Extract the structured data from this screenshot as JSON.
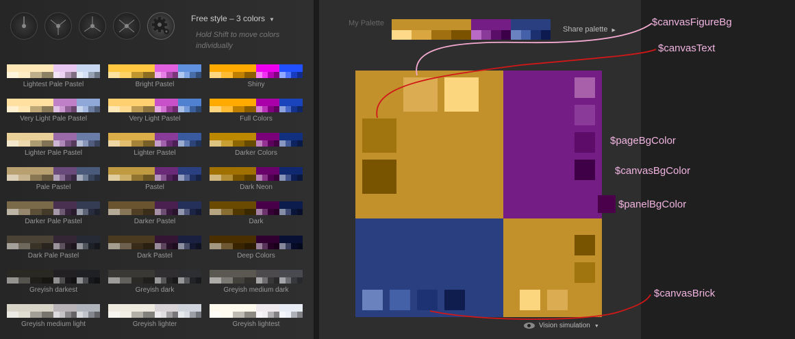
{
  "header": {
    "mode_label": "Free style – 3 colors",
    "hint": "Hold Shift to move colors individually"
  },
  "icons": [
    "mono-wheel-icon",
    "complement-wheel-icon",
    "triad-wheel-icon",
    "tetrad-wheel-icon",
    "gear-icon"
  ],
  "presets": [
    {
      "name": "Lightest Pale Pastel",
      "colors": [
        "#ffe8b8",
        "#e8c8f0",
        "#c8d8f0"
      ]
    },
    {
      "name": "Bright Pastel",
      "colors": [
        "#ffc840",
        "#e060e0",
        "#6090e0"
      ]
    },
    {
      "name": "Shiny",
      "colors": [
        "#ffaa00",
        "#ee00ee",
        "#2050ff"
      ]
    },
    {
      "name": "Very Light Pale Pastel",
      "colors": [
        "#ffe0a0",
        "#c080c8",
        "#90a8d8"
      ]
    },
    {
      "name": "Very Light Pastel",
      "colors": [
        "#ffd070",
        "#c850c8",
        "#5080d0"
      ]
    },
    {
      "name": "Full Colors",
      "colors": [
        "#ffaa00",
        "#aa00aa",
        "#1a44bb"
      ]
    },
    {
      "name": "Lighter Pale Pastel",
      "colors": [
        "#e8d098",
        "#9a6aa8",
        "#6a7ca8"
      ]
    },
    {
      "name": "Lighter Pastel",
      "colors": [
        "#dcae4a",
        "#8a3a98",
        "#3a5aa0"
      ]
    },
    {
      "name": "Darker Colors",
      "colors": [
        "#bb8800",
        "#7a007a",
        "#123080"
      ]
    },
    {
      "name": "Pale Pastel",
      "colors": [
        "#b8a070",
        "#6a4a7a",
        "#4a5a7a"
      ]
    },
    {
      "name": "Pastel",
      "colors": [
        "#c09a40",
        "#6a2a78",
        "#2a4080"
      ]
    },
    {
      "name": "Dark Neon",
      "colors": [
        "#a07000",
        "#6a006a",
        "#102870"
      ]
    },
    {
      "name": "Darker Pale Pastel",
      "colors": [
        "#7a6a4a",
        "#4a3050",
        "#343c54"
      ]
    },
    {
      "name": "Darker Pastel",
      "colors": [
        "#6a5430",
        "#4a2050",
        "#24305a"
      ]
    },
    {
      "name": "Dark",
      "colors": [
        "#6a4a00",
        "#480048",
        "#0c1c4c"
      ]
    },
    {
      "name": "Dark Pale Pastel",
      "colors": [
        "#4a4234",
        "#342634",
        "#262a34"
      ]
    },
    {
      "name": "Dark Pastel",
      "colors": [
        "#4a3a20",
        "#341634",
        "#1a2040"
      ]
    },
    {
      "name": "Deep Colors",
      "colors": [
        "#4a3000",
        "#300030",
        "#081034"
      ]
    },
    {
      "name": "Greyish darkest",
      "colors": [
        "#2a2822",
        "#222022",
        "#1e2024"
      ]
    },
    {
      "name": "Greyish dark",
      "colors": [
        "#3a3834",
        "#302e30",
        "#2c2e32"
      ]
    },
    {
      "name": "Greyish medium dark",
      "colors": [
        "#5a5850",
        "#4c4a4c",
        "#484a50"
      ]
    },
    {
      "name": "Greyish medium light",
      "colors": [
        "#d8d4c8",
        "#b8b4b8",
        "#b0b4bc"
      ]
    },
    {
      "name": "Greyish lighter",
      "colors": [
        "#eeeae0",
        "#d8d4d8",
        "#d0d4dc"
      ]
    },
    {
      "name": "Greyish lightest",
      "colors": [
        "#fffaee",
        "#eeeaee",
        "#e8ecf4"
      ]
    }
  ],
  "palette": {
    "label": "My Palette",
    "share_label": "Share palette",
    "colors": {
      "gold": "#c2912c",
      "purple": "#741d85",
      "blue": "#2a3f80"
    },
    "shades": {
      "gold": [
        "#ffd98a",
        "#d9a640",
        "#a07010",
        "#7a5200"
      ],
      "purple": [
        "#b86ac4",
        "#8a3a98",
        "#5a0e68",
        "#3c0048"
      ],
      "blue": [
        "#6a82c0",
        "#4460a8",
        "#1c3070",
        "#0c1a50"
      ]
    }
  },
  "canvas": {
    "quadrants": [
      "#c2912c",
      "#741d85",
      "#2a3f80",
      "#c2912c"
    ],
    "gold_light_bricks": [
      "#dcac52",
      "#fcd67e"
    ],
    "gold_dark_bricks": [
      "#a07510",
      "#785400"
    ],
    "purple_bricks": [
      "#a860aa",
      "#8a3a98",
      "#5e0c6a",
      "#400048"
    ],
    "blue_bricks": [
      "#6a82be",
      "#4460a6",
      "#1c3272",
      "#0e1c4e"
    ],
    "br_dark_bricks": [
      "#785400",
      "#a07510"
    ],
    "br_light_bricks": [
      "#fcd67e",
      "#dcac52"
    ],
    "panel_swatch": "#4a004a"
  },
  "annotations": {
    "canvasFigureBg": "$canvasFigureBg",
    "canvasText": "$canvasText",
    "pageBgColor": "$pageBgColor",
    "canvasBgColor": "$canvasBgColor",
    "panelBgColor": "$panelBgColor",
    "canvasBrick": "$canvasBrick",
    "line_pink": "#f4aad0",
    "line_red": "#d01818"
  },
  "footer": {
    "vision_label": "Vision simulation"
  }
}
